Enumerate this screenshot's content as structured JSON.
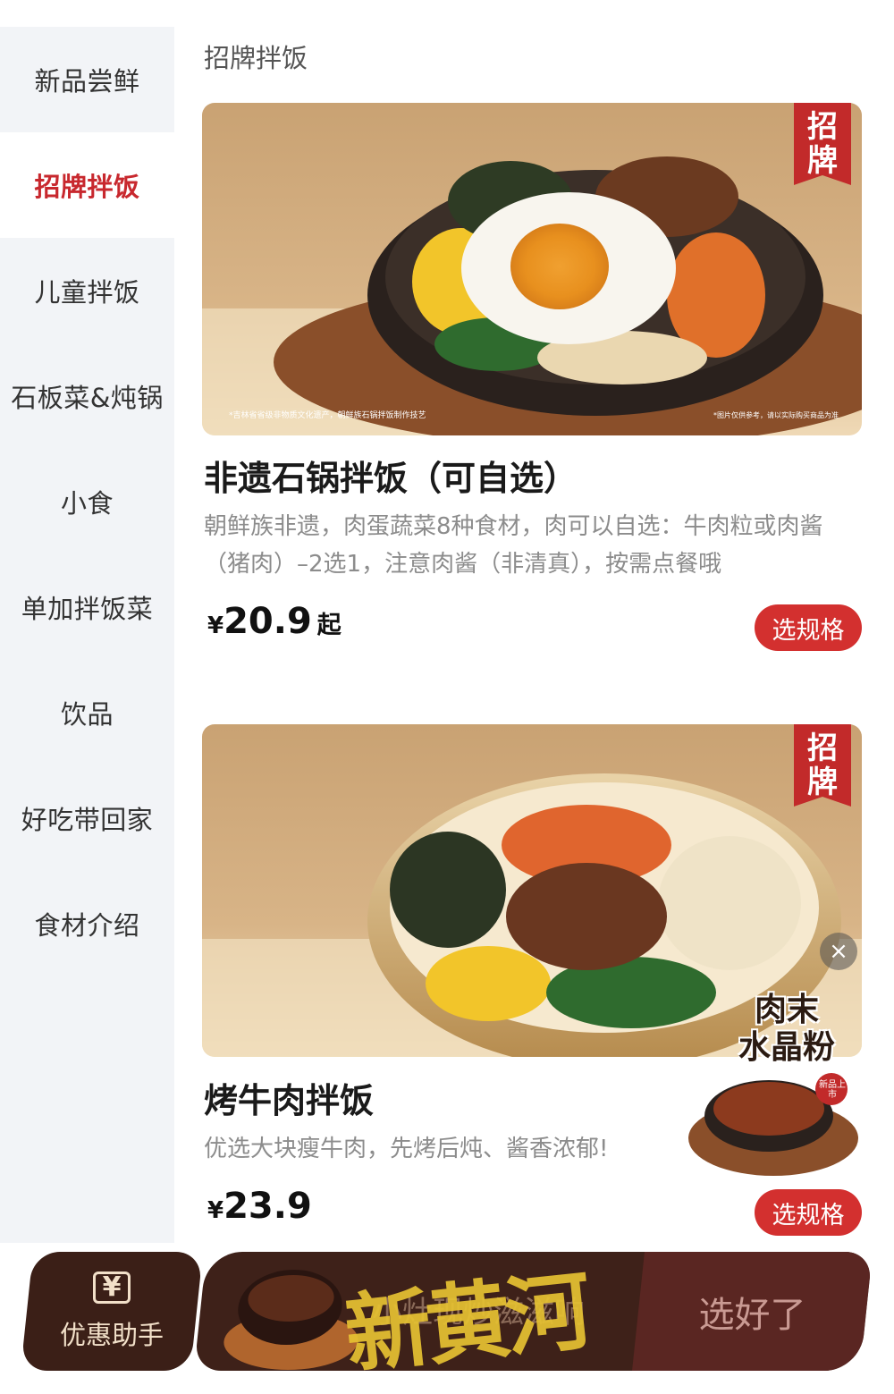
{
  "sidebar": {
    "items": [
      {
        "label": "新品尝鲜"
      },
      {
        "label": "招牌拌饭"
      },
      {
        "label": "儿童拌饭"
      },
      {
        "label": "石板菜&炖锅"
      },
      {
        "label": "小食"
      },
      {
        "label": "单加拌饭菜"
      },
      {
        "label": "饮品"
      },
      {
        "label": "好吃带回家"
      },
      {
        "label": "食材介绍"
      }
    ],
    "active_index": 1
  },
  "section": {
    "title": "招牌拌饭"
  },
  "products": [
    {
      "badge_line1": "招",
      "badge_line2": "牌",
      "image_caption_left": "*吉林省省级非物质文化遗产，朝鲜族石锅拌饭制作技艺",
      "image_caption_right": "*图片仅供参考，请以实际购买商品为准",
      "name": "非遗石锅拌饭（可自选）",
      "desc": "朝鲜族非遗，肉蛋蔬菜8种食材，肉可以自选：牛肉粒或肉酱（猪肉）–2选1，注意肉酱（非清真），按需点餐哦",
      "price_symbol": "¥",
      "price": "20.9",
      "price_suffix": "起",
      "button": "选规格"
    },
    {
      "badge_line1": "招",
      "badge_line2": "牌",
      "name": "烤牛肉拌饭",
      "desc": "优选大块瘦牛肉，先烤后炖、酱香浓郁!",
      "price_symbol": "¥",
      "price": "23.9",
      "button": "选规格"
    }
  ],
  "promo_float": {
    "title_line1": "肉末",
    "title_line2": "水晶粉",
    "tag": "新品上市",
    "close": "×"
  },
  "bottom_bar": {
    "coupon_icon": "¥",
    "coupon_label": "优惠助手",
    "cart_text": "小灶现炒滋滋响",
    "checkout_label": "选好了"
  },
  "watermark": "新黄河",
  "colors": {
    "accent": "#c8282e",
    "button": "#d3302f",
    "sidebar_bg": "#f2f4f7",
    "bar_dark": "#3e2119"
  }
}
